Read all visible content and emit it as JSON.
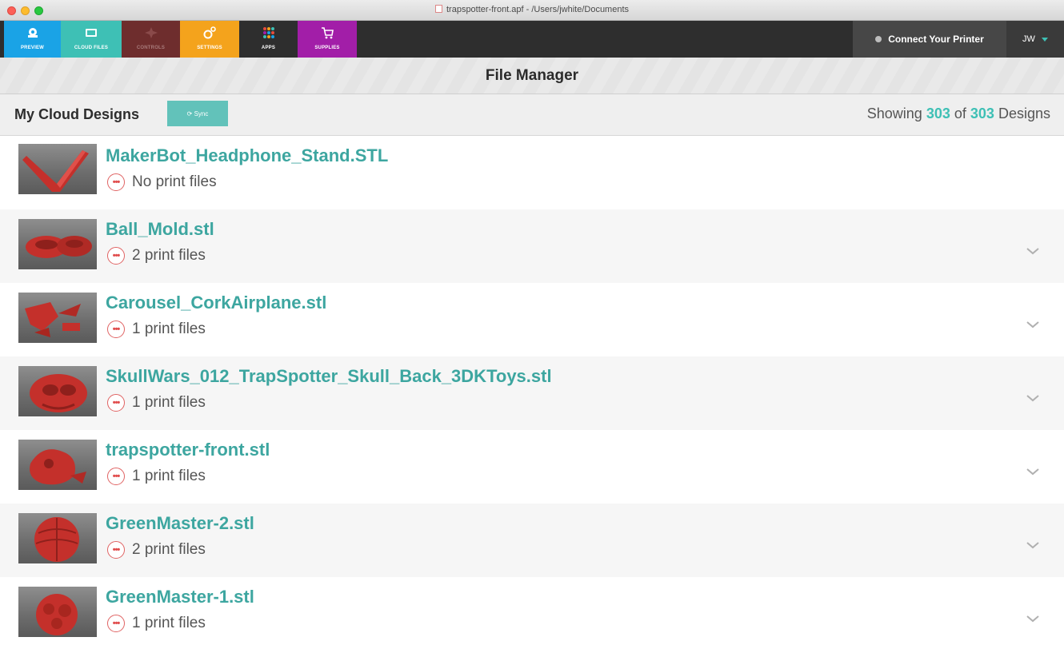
{
  "window": {
    "title": "trapspotter-front.apf - /Users/jwhite/Documents"
  },
  "toolbar": {
    "tabs": [
      {
        "label": "PREVIEW",
        "icon": "preview-icon",
        "color": "#1aa3e6"
      },
      {
        "label": "CLOUD FILES",
        "icon": "cloud-files-icon",
        "color": "#3ec0b5"
      },
      {
        "label": "CONTROLS",
        "icon": "controls-icon",
        "color": "#6e2d2d"
      },
      {
        "label": "SETTINGS",
        "icon": "settings-icon",
        "color": "#f4a31c"
      },
      {
        "label": "APPS",
        "icon": "apps-icon",
        "color": "#2e2e2e"
      },
      {
        "label": "SUPPLIES",
        "icon": "cart-icon",
        "color": "#a21ea8"
      }
    ],
    "connect_label": "Connect Your Printer",
    "user_initials": "JW"
  },
  "page": {
    "title": "File Manager"
  },
  "subbar": {
    "section_title": "My Cloud Designs",
    "sync_label": "⟳ Sync",
    "showing_prefix": "Showing",
    "showing_count": "303",
    "showing_of": "of",
    "showing_total": "303",
    "showing_suffix": "Designs"
  },
  "files": [
    {
      "name": "MakerBot_Headphone_Stand.STL",
      "prints": "No print files",
      "expandable": false
    },
    {
      "name": "Ball_Mold.stl",
      "prints": "2 print files",
      "expandable": true
    },
    {
      "name": "Carousel_CorkAirplane.stl",
      "prints": "1 print files",
      "expandable": true
    },
    {
      "name": "SkullWars_012_TrapSpotter_Skull_Back_3DKToys.stl",
      "prints": "1 print files",
      "expandable": true
    },
    {
      "name": "trapspotter-front.stl",
      "prints": "1 print files",
      "expandable": true
    },
    {
      "name": "GreenMaster-2.stl",
      "prints": "2 print files",
      "expandable": true
    },
    {
      "name": "GreenMaster-1.stl",
      "prints": "1 print files",
      "expandable": true
    }
  ],
  "colors": {
    "accent": "#3ec0b5",
    "file_name": "#3da6a0",
    "model": "#c4302b"
  }
}
